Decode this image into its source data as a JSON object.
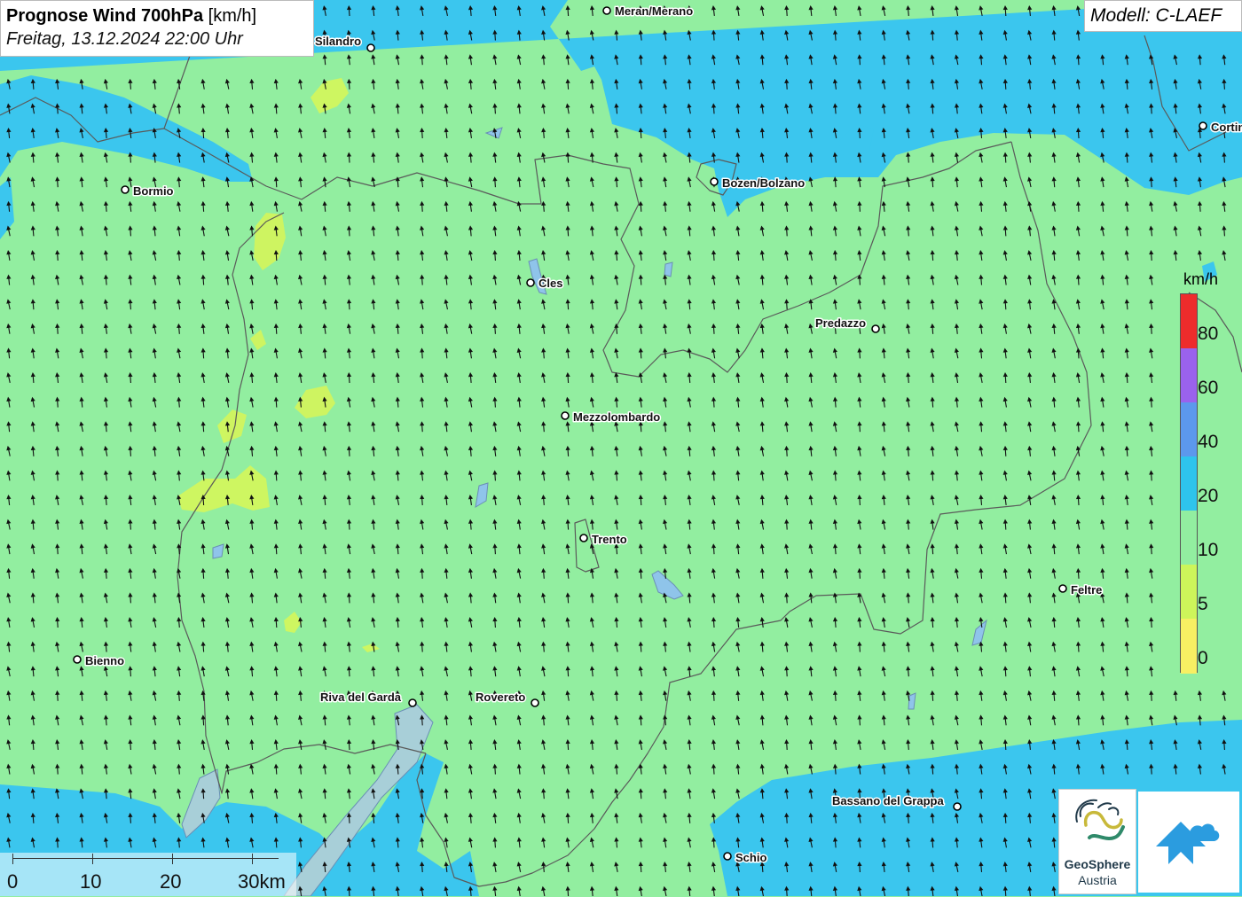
{
  "title": {
    "main_bold": "Prognose Wind 700hPa",
    "main_unit": "[km/h]",
    "datetime": "Freitag, 13.12.2024 22:00 Uhr"
  },
  "model": "Modell: C-LAEF",
  "legend": {
    "unit": "km/h",
    "labels": [
      "80",
      "60",
      "40",
      "20",
      "10",
      "5",
      "0"
    ],
    "colors": {
      "c80": "#ee2c2c",
      "c60": "#9a62ec",
      "c40": "#5c98ec",
      "c20": "#2ec4ec",
      "c10": "#92eea0",
      "c5": "#cdf55a",
      "c0": "#f7ef63"
    }
  },
  "scale": {
    "labels": [
      "0",
      "10",
      "20",
      "30km"
    ]
  },
  "cities": [
    {
      "name": "Meran/Merano"
    },
    {
      "name": "Silandro"
    },
    {
      "name": "Bormio"
    },
    {
      "name": "Bozen/Bolzano"
    },
    {
      "name": "Cortina"
    },
    {
      "name": "Cles"
    },
    {
      "name": "Predazzo"
    },
    {
      "name": "Mezzolombardo"
    },
    {
      "name": "Trento"
    },
    {
      "name": "Feltre"
    },
    {
      "name": "Bienno"
    },
    {
      "name": "Riva del Garda"
    },
    {
      "name": "Rovereto"
    },
    {
      "name": "Bassano del Grappa"
    },
    {
      "name": "Schio"
    }
  ],
  "wind": {
    "direction": "north-north-west"
  },
  "logos": {
    "geosphere_line1": "GeoSphere",
    "geosphere_line2": "Austria",
    "app_icon": "weather-app-icon"
  }
}
